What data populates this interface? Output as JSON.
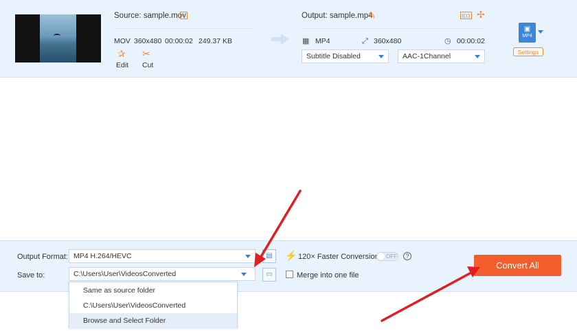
{
  "source": {
    "label": "Source: sample.mov",
    "format": "MOV",
    "resolution": "360x480",
    "duration": "00:00:02",
    "size": "249.37 KB",
    "tools": [
      {
        "label": "Edit",
        "icon": "edit-star-icon"
      },
      {
        "label": "Cut",
        "icon": "scissors-icon"
      }
    ]
  },
  "output": {
    "label": "Output: sample.mp4",
    "format": "MP4",
    "resolution": "360x480",
    "duration": "00:00:02",
    "subtitle_select": "Subtitle Disabled",
    "audio_select": "AAC-1Channel",
    "id3_badge": "ID3",
    "format_badge": "MP4",
    "settings_label": "Settings"
  },
  "bottom": {
    "output_format_label": "Output Format:",
    "output_format_value": "MP4 H.264/HEVC",
    "save_to_label": "Save to:",
    "save_to_value": "C:\\Users\\User\\VideosConverted",
    "faster_conversion_label": "120× Faster Conversion",
    "toggle_state": "OFF",
    "help_glyph": "?",
    "merge_label": "Merge into one file",
    "convert_label": "Convert All"
  },
  "dropdown": {
    "items": [
      "Same as source folder",
      "C:\\Users\\User\\VideosConverted",
      "Browse and Select Folder"
    ],
    "highlighted_index": 2
  },
  "colors": {
    "accent_orange": "#f08a2c",
    "convert_button": "#f25f2c",
    "panel_bg": "#e8f3fd",
    "caret_blue": "#3a7bd5",
    "annotation_arrow": "#e02020"
  }
}
